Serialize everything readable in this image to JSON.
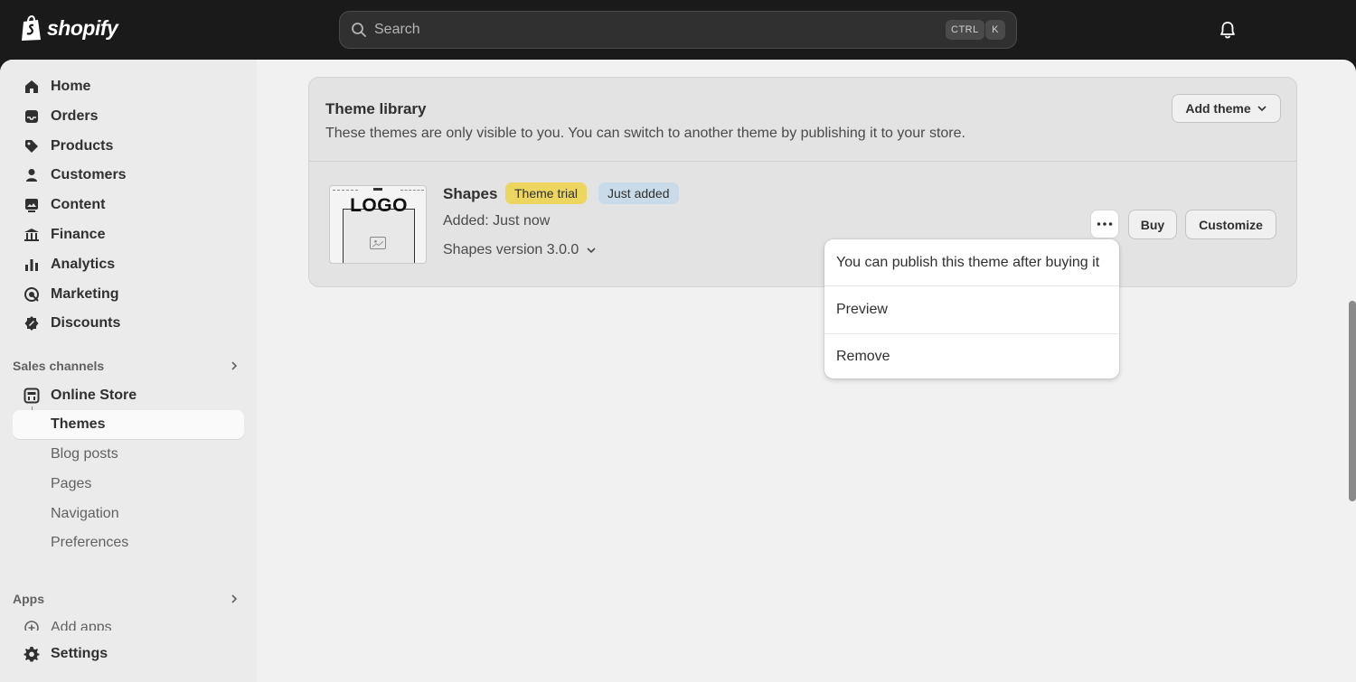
{
  "topbar": {
    "brand": "shopify",
    "search_placeholder": "Search",
    "shortcut_ctrl": "CTRL",
    "shortcut_key": "K"
  },
  "sidebar": {
    "items": [
      {
        "label": "Home",
        "icon": "home-icon"
      },
      {
        "label": "Orders",
        "icon": "inbox-icon"
      },
      {
        "label": "Products",
        "icon": "tag-icon"
      },
      {
        "label": "Customers",
        "icon": "person-icon"
      },
      {
        "label": "Content",
        "icon": "image-icon"
      },
      {
        "label": "Finance",
        "icon": "bank-icon"
      },
      {
        "label": "Analytics",
        "icon": "bar-chart-icon"
      },
      {
        "label": "Marketing",
        "icon": "target-icon"
      },
      {
        "label": "Discounts",
        "icon": "discount-icon"
      }
    ],
    "sales_channels_label": "Sales channels",
    "online_store_label": "Online Store",
    "sub_items": [
      "Themes",
      "Blog posts",
      "Pages",
      "Navigation",
      "Preferences"
    ],
    "apps_label": "Apps",
    "add_apps_label": "Add apps",
    "settings_label": "Settings"
  },
  "theme_library": {
    "title": "Theme library",
    "description": "These themes are only visible to you. You can switch to another theme by publishing it to your store.",
    "add_theme_label": "Add theme",
    "theme": {
      "name": "Shapes",
      "badge_trial": "Theme trial",
      "badge_added": "Just added",
      "added_text": "Added: Just now",
      "version": "Shapes version 3.0.0",
      "thumb_logo": "LOGO",
      "buy_label": "Buy",
      "customize_label": "Customize"
    }
  },
  "menu": {
    "items": [
      "You can publish this theme after buying it",
      "Preview",
      "Remove"
    ]
  },
  "colors": {
    "topbar": "#1a1a1a",
    "badge_trial": "#ecd65f",
    "badge_added": "#c9dbe8"
  }
}
